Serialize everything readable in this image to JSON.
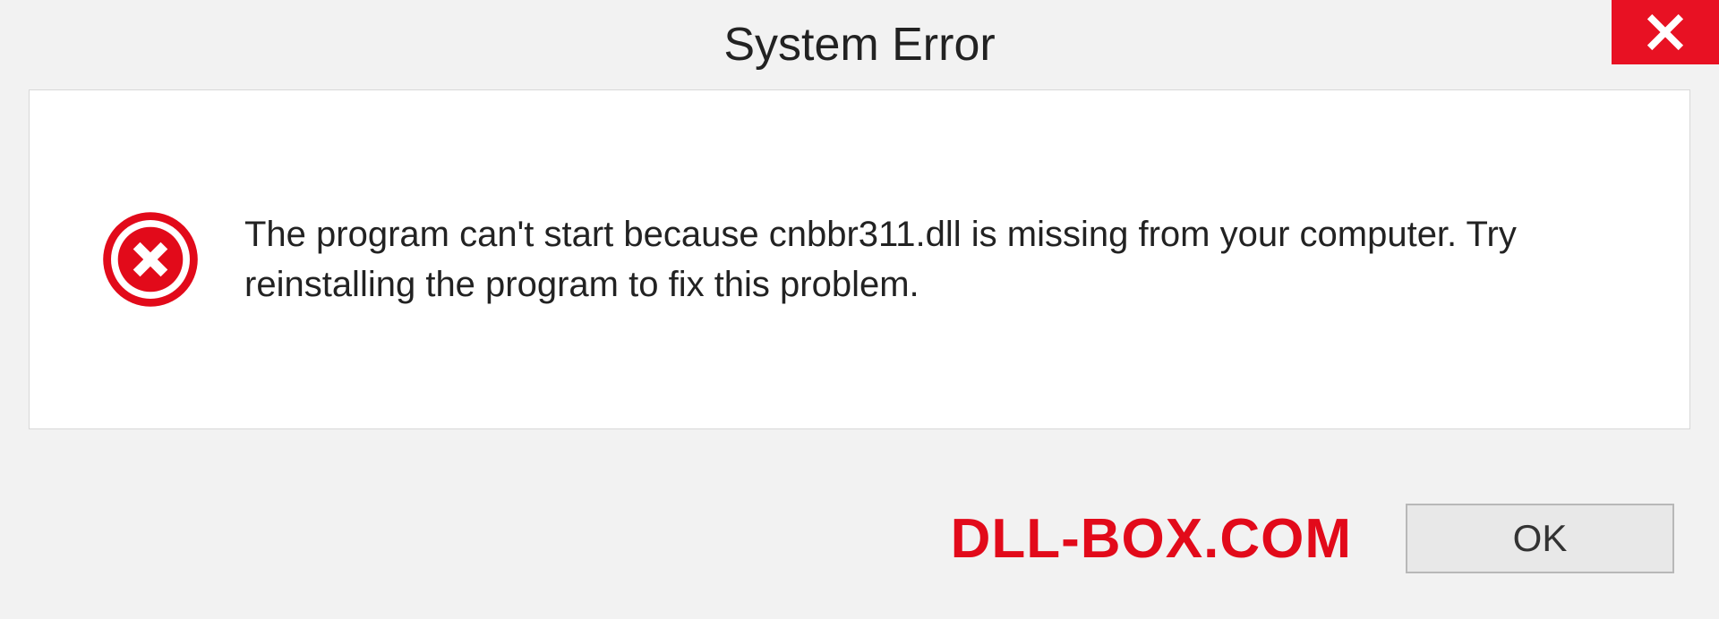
{
  "titlebar": {
    "title": "System Error"
  },
  "dialog": {
    "message": "The program can't start because cnbbr311.dll is missing from your computer. Try reinstalling the program to fix this problem."
  },
  "footer": {
    "watermark": "DLL-BOX.COM",
    "ok_label": "OK"
  },
  "colors": {
    "close_bg": "#e81123",
    "error_icon": "#e20a1a",
    "watermark": "#e20a1a"
  }
}
